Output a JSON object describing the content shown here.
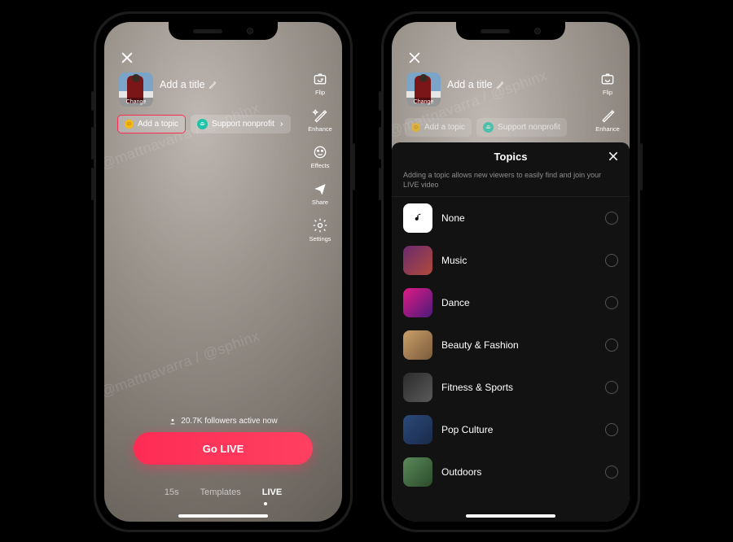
{
  "watermark": "@mattnavarra / @sphinx",
  "camera": {
    "title_placeholder": "Add a title",
    "thumb_change": "Change",
    "add_topic": "Add a topic",
    "support_nonprofit": "Support nonprofit",
    "tools": {
      "flip": "Flip",
      "enhance": "Enhance",
      "effects": "Effects",
      "share": "Share",
      "settings": "Settings"
    },
    "followers_active": "20.7K followers active now",
    "go_live": "Go LIVE",
    "modes": {
      "m15s": "15s",
      "templates": "Templates",
      "live": "LIVE"
    }
  },
  "topics_panel": {
    "heading": "Topics",
    "subtitle": "Adding a topic allows new viewers to easily find and join your LIVE video",
    "items": [
      {
        "label": "None",
        "thumb": "none"
      },
      {
        "label": "Music",
        "thumb": "music"
      },
      {
        "label": "Dance",
        "thumb": "dance"
      },
      {
        "label": "Beauty & Fashion",
        "thumb": "beauty"
      },
      {
        "label": "Fitness & Sports",
        "thumb": "fitness"
      },
      {
        "label": "Pop Culture",
        "thumb": "pop"
      },
      {
        "label": "Outdoors",
        "thumb": "outdoors"
      }
    ]
  }
}
